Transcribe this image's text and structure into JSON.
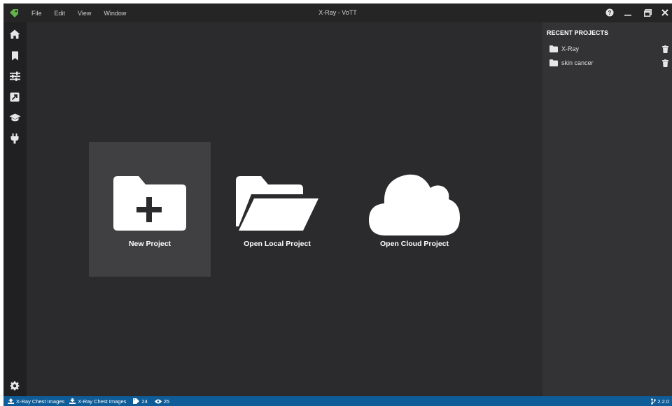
{
  "window": {
    "title": "X-Ray - VoTT"
  },
  "menu": {
    "items": [
      "File",
      "Edit",
      "View",
      "Window"
    ]
  },
  "sidebar": {
    "icons": [
      "home-icon",
      "bookmark-icon",
      "sliders-icon",
      "export-icon",
      "graduation-cap-icon",
      "plug-icon",
      "gear-icon"
    ]
  },
  "main": {
    "tiles": [
      {
        "label": "New Project",
        "icon": "new-folder-icon",
        "selected": true
      },
      {
        "label": "Open Local Project",
        "icon": "open-folder-icon",
        "selected": false
      },
      {
        "label": "Open Cloud Project",
        "icon": "cloud-icon",
        "selected": false
      }
    ]
  },
  "recent_projects": {
    "title": "RECENT PROJECTS",
    "items": [
      {
        "name": "X-Ray"
      },
      {
        "name": "skin cancer"
      }
    ]
  },
  "statusbar": {
    "source_connection": "X-Ray Chest Images",
    "target_connection": "X-Ray Chest Images",
    "tag_count": "24",
    "visited_count": "25",
    "version": "2.2.0"
  },
  "colors": {
    "background": "#2b2b2d",
    "titlebar": "#252526",
    "sidebar": "#202022",
    "right_panel": "#333335",
    "selected_tile": "#404043",
    "statusbar": "#0e5d99",
    "logo": "#5fb34a"
  }
}
